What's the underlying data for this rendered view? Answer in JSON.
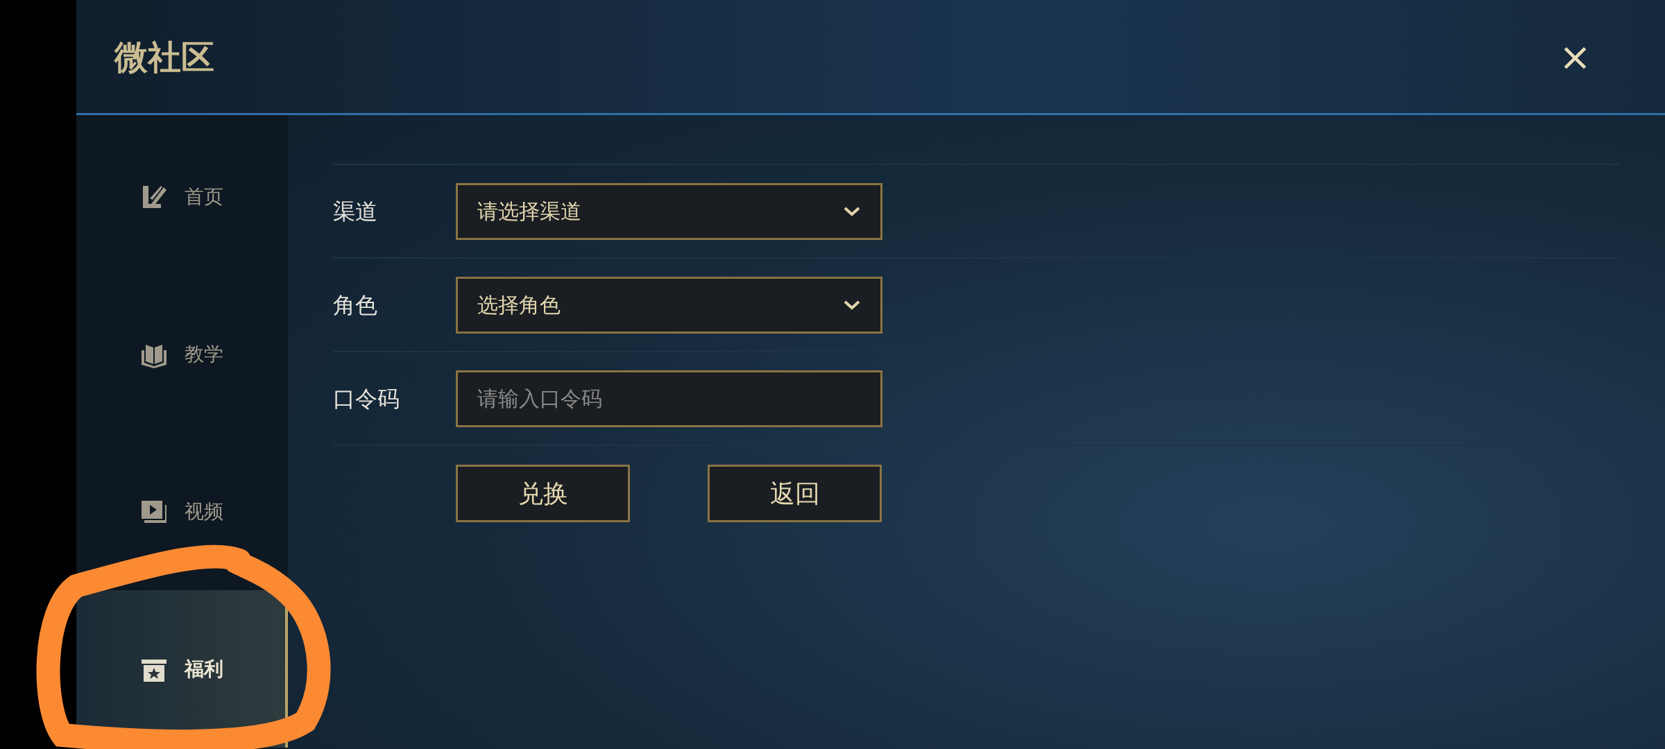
{
  "header": {
    "title": "微社区",
    "close": "×"
  },
  "sidebar": {
    "items": [
      {
        "label": "首页",
        "selected": false
      },
      {
        "label": "教学",
        "selected": false
      },
      {
        "label": "视频",
        "selected": false
      },
      {
        "label": "福利",
        "selected": true
      }
    ]
  },
  "form": {
    "fields": [
      {
        "label": "渠道",
        "kind": "select",
        "value": "请选择渠道"
      },
      {
        "label": "角色",
        "kind": "select",
        "value": "选择角色"
      },
      {
        "label": "口令码",
        "kind": "input",
        "placeholder": "请输入口令码"
      }
    ],
    "buttons": [
      "兑换",
      "返回"
    ]
  }
}
